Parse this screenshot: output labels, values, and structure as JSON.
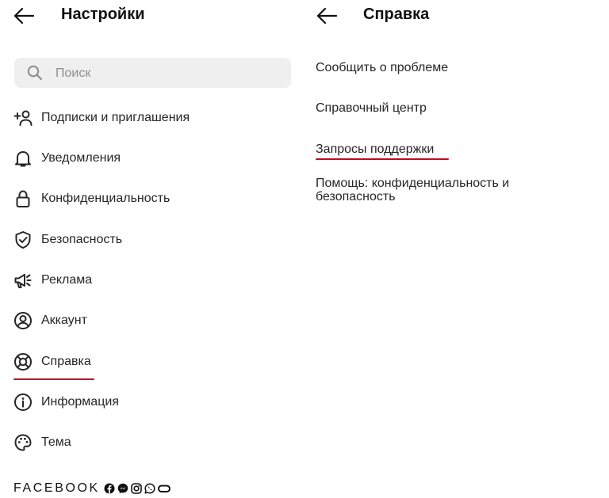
{
  "settings": {
    "title": "Настройки",
    "search_placeholder": "Поиск",
    "items": [
      {
        "label": "Подписки и приглашения",
        "icon": "add-person-icon"
      },
      {
        "label": "Уведомления",
        "icon": "bell-icon"
      },
      {
        "label": "Конфиденциальность",
        "icon": "lock-icon"
      },
      {
        "label": "Безопасность",
        "icon": "shield-icon"
      },
      {
        "label": "Реклама",
        "icon": "megaphone-icon"
      },
      {
        "label": "Аккаунт",
        "icon": "account-icon"
      },
      {
        "label": "Справка",
        "icon": "lifebuoy-icon",
        "highlighted": true
      },
      {
        "label": "Информация",
        "icon": "info-icon"
      },
      {
        "label": "Тема",
        "icon": "palette-icon"
      }
    ],
    "footer": {
      "brand": "FACEBOOK",
      "apps": [
        "facebook-icon",
        "messenger-icon",
        "instagram-icon",
        "whatsapp-icon",
        "oculus-icon"
      ]
    }
  },
  "help": {
    "title": "Справка",
    "items": [
      {
        "label": "Сообщить  о проблеме"
      },
      {
        "label": "Справочный центр"
      },
      {
        "label": "Запросы поддержки",
        "highlighted": true
      },
      {
        "label_line1": "Помощь: конфиденциальность и",
        "label_line2": "безопасность"
      }
    ]
  },
  "colors": {
    "text": "#262626",
    "search_bg": "#efefef",
    "placeholder": "#8e8e8e",
    "highlight_underline": "#d0021b"
  }
}
